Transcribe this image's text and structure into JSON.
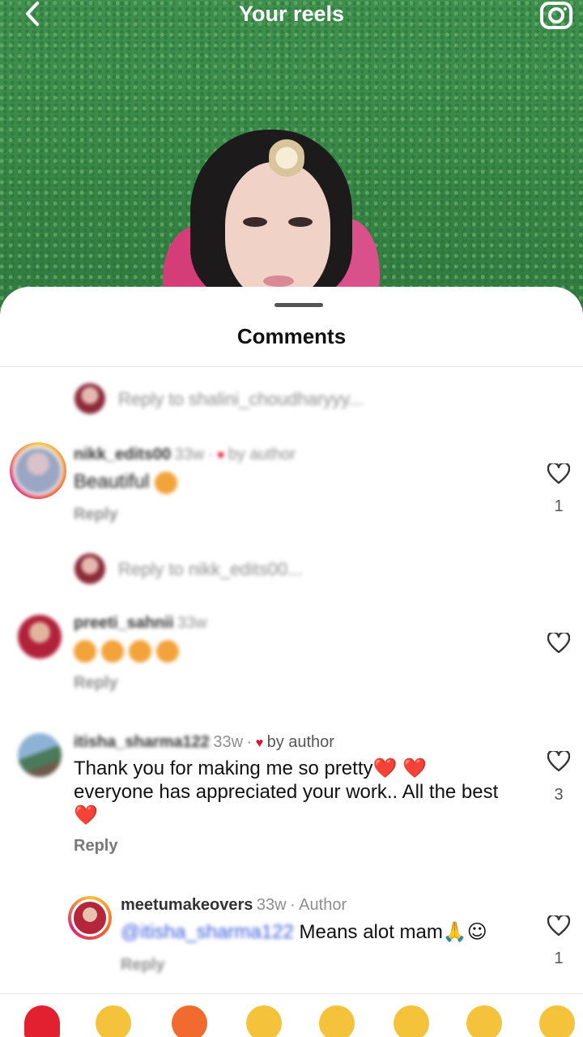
{
  "header": {
    "title": "Your reels"
  },
  "sheet": {
    "title": "Comments"
  },
  "comments": [
    {
      "reply_prompt": "Reply to shalini_choudharyyy..."
    },
    {
      "username": "nikk_edits00",
      "age": "33w",
      "by_author": "by author",
      "text": "Beautiful",
      "reply": "Reply",
      "likes": "1"
    },
    {
      "reply_prompt": "Reply to nikk_edits00..."
    },
    {
      "username": "preeti_sahnii",
      "age": "33w",
      "reply": "Reply"
    },
    {
      "username": "itisha_sharma122",
      "age": "33w",
      "by_author": "by author",
      "text_line1": "Thank you for making me so pretty",
      "text_line2": "everyone has appreciated your work.. All the best",
      "reply": "Reply",
      "likes": "3"
    },
    {
      "username": "meetumakeovers",
      "age": "33w",
      "role": "Author",
      "mention": "@itisha_sharma122",
      "text": "Means alot mam",
      "reply": "Reply",
      "likes": "1"
    }
  ],
  "icons": {
    "back": "chevron-left-icon",
    "camera": "camera-icon",
    "like": "heart-outline-icon",
    "liked_by_author": "heart-filled-icon"
  },
  "colors": {
    "accent_red": "#e0102b",
    "sheet_bg": "#ffffff",
    "muted": "#8e8e8e"
  }
}
